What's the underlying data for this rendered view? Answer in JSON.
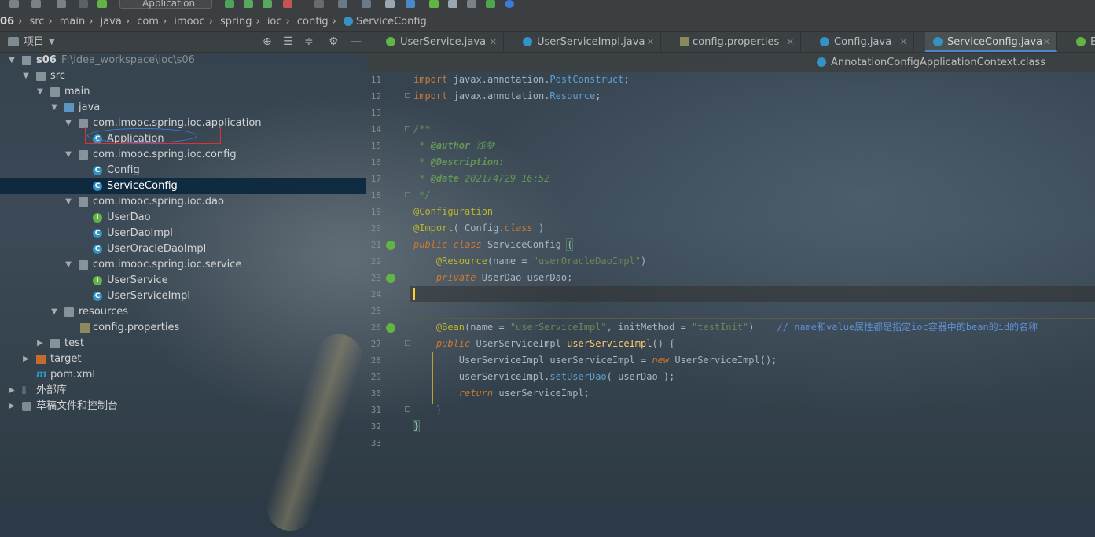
{
  "toolbar": {
    "run_config": "Application"
  },
  "breadcrumb": [
    "06",
    "src",
    "main",
    "java",
    "com",
    "imooc",
    "spring",
    "ioc",
    "config",
    "ServiceConfig"
  ],
  "project_panel": {
    "title": "项目",
    "tools": [
      "target-icon",
      "expand-all-icon",
      "collapse-all-icon",
      "gear-icon",
      "minimize-icon"
    ]
  },
  "tree": [
    {
      "label": "s06",
      "path": "F:\\idea_workspace\\ioc\\s06",
      "icon": "module-folder-icon",
      "depth": 0,
      "expanded": true
    },
    {
      "label": "src",
      "icon": "folder-icon",
      "depth": 1,
      "expanded": true
    },
    {
      "label": "main",
      "icon": "folder-icon",
      "depth": 2,
      "expanded": true
    },
    {
      "label": "java",
      "icon": "source-folder-icon",
      "depth": 3,
      "expanded": true
    },
    {
      "label": "com.imooc.spring.ioc.application",
      "icon": "package-icon",
      "depth": 4,
      "expanded": true
    },
    {
      "label": "Application",
      "icon": "class-icon",
      "depth": 5
    },
    {
      "label": "com.imooc.spring.ioc.config",
      "icon": "package-icon",
      "depth": 4,
      "expanded": true
    },
    {
      "label": "Config",
      "icon": "class-icon",
      "depth": 5
    },
    {
      "label": "ServiceConfig",
      "icon": "class-icon",
      "depth": 5,
      "selected": true
    },
    {
      "label": "com.imooc.spring.ioc.dao",
      "icon": "package-icon",
      "depth": 4,
      "expanded": true
    },
    {
      "label": "UserDao",
      "icon": "interface-icon",
      "depth": 5
    },
    {
      "label": "UserDaoImpl",
      "icon": "class-icon",
      "depth": 5
    },
    {
      "label": "UserOracleDaoImpl",
      "icon": "class-icon",
      "depth": 5
    },
    {
      "label": "com.imooc.spring.ioc.service",
      "icon": "package-icon",
      "depth": 4,
      "expanded": true
    },
    {
      "label": "UserService",
      "icon": "interface-icon",
      "depth": 5
    },
    {
      "label": "UserServiceImpl",
      "icon": "class-icon",
      "depth": 5
    },
    {
      "label": "resources",
      "icon": "resources-folder-icon",
      "depth": 3,
      "expanded": true
    },
    {
      "label": "config.properties",
      "icon": "properties-file-icon",
      "depth": 4
    },
    {
      "label": "test",
      "icon": "folder-icon",
      "depth": 2,
      "expanded": false
    },
    {
      "label": "target",
      "icon": "excluded-folder-icon",
      "depth": 1,
      "expanded": false
    },
    {
      "label": "pom.xml",
      "icon": "maven-icon",
      "depth": 1
    },
    {
      "label": "外部库",
      "icon": "library-icon",
      "depth": 0,
      "expanded": false
    },
    {
      "label": "草稿文件和控制台",
      "icon": "scratch-icon",
      "depth": 0,
      "expanded": false
    }
  ],
  "editor_tabs": [
    {
      "label": "UserService.java",
      "icon": "interface-icon",
      "active": false
    },
    {
      "label": "UserServiceImpl.java",
      "icon": "class-icon",
      "active": false
    },
    {
      "label": "config.properties",
      "icon": "properties-file-icon",
      "active": false
    },
    {
      "label": "Config.java",
      "icon": "class-icon",
      "active": false
    },
    {
      "label": "ServiceConfig.java",
      "icon": "class-icon",
      "active": true
    },
    {
      "label": "E",
      "icon": "class-icon",
      "active": false
    }
  ],
  "editor_tabs_row2": [
    {
      "label": "AnnotationConfigApplicationContext.class",
      "icon": "class-icon",
      "active": false
    }
  ],
  "code": {
    "line_numbers": [
      "11",
      "12",
      "13",
      "14",
      "15",
      "16",
      "17",
      "18",
      "19",
      "20",
      "21",
      "22",
      "23",
      "24",
      "25",
      "26",
      "27",
      "28",
      "29",
      "30",
      "31",
      "32",
      "33"
    ],
    "l11": {
      "kw": "import",
      "pkg": "javax.annotation.",
      "name": "PostConstruct",
      "end": ";"
    },
    "l12": {
      "kw": "import",
      "pkg": "javax.annotation.",
      "name": "Resource",
      "end": ";"
    },
    "l14": "/**",
    "l15": {
      "star": " * ",
      "tag": "@author",
      "text": " 浅梦"
    },
    "l16": {
      "star": " * ",
      "tag": "@Description:"
    },
    "l17": {
      "star": " * ",
      "tag": "@date",
      "text": " 2021/4/29 16:52"
    },
    "l18": " */",
    "l19": "@Configuration",
    "l20": {
      "ann": "@Import",
      "open": "( ",
      "cls": "Config",
      "dot": ".",
      "kw": "class",
      "close": " )"
    },
    "l21": {
      "kw1": "public",
      "kw2": "class",
      "name": "ServiceConfig",
      "brace": "{"
    },
    "l22": {
      "ann": "@Resource",
      "open": "(name = ",
      "str": "\"userOracleDaoImpl\"",
      "close": ")"
    },
    "l23": {
      "kw": "private",
      "type": "UserDao",
      "name": "userDao",
      "end": ";"
    },
    "l26": {
      "ann": "@Bean",
      "open": "(name = ",
      "str1": "\"userServiceImpl\"",
      "mid": ", initMethod = ",
      "str2": "\"testInit\"",
      "close": ")",
      "comment": "// name和value属性都是指定ioc容器中的bean的id的名称"
    },
    "l27": {
      "kw": "public",
      "type": "UserServiceImpl",
      "name": "userServiceImpl",
      "rest": "() {"
    },
    "l28": {
      "type": "UserServiceImpl",
      "var": " userServiceImpl = ",
      "kw": "new",
      "ctor": "UserServiceImpl",
      "end": "();"
    },
    "l29": {
      "obj": "userServiceImpl.",
      "call": "setUserDao",
      "args": "( userDao );"
    },
    "l30": {
      "kw": "return",
      "rest": " userServiceImpl;"
    },
    "l31": "}",
    "l32": "}"
  },
  "colors": {
    "accent": "#4a88c7",
    "selection": "#0d293e",
    "highlight_box": "#e03030"
  }
}
